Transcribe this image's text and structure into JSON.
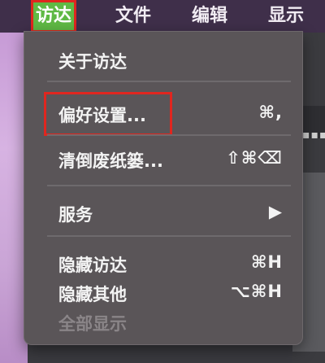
{
  "menubar": {
    "apple_glyph": "",
    "menus": [
      "访达",
      "文件",
      "编辑",
      "显示"
    ]
  },
  "dropdown": {
    "items": [
      {
        "label": "关于访达",
        "shortcut": ""
      },
      {
        "label": "偏好设置...",
        "shortcut": "⌘,"
      },
      {
        "label": "清倒废纸篓...",
        "shortcut": "⇧⌘⌫"
      },
      {
        "label": "服务",
        "shortcut": "▶"
      },
      {
        "label": "隐藏访达",
        "shortcut": "⌘H"
      },
      {
        "label": "隐藏其他",
        "shortcut": "⌥⌘H"
      },
      {
        "label": "全部显示",
        "shortcut": ""
      }
    ]
  },
  "colors": {
    "active_menu_bg": "#5fb944",
    "highlight_border": "#e0261f",
    "menu_bg": "#5a5558"
  },
  "icons": [
    "apple-icon",
    "submenu-arrow-icon"
  ]
}
